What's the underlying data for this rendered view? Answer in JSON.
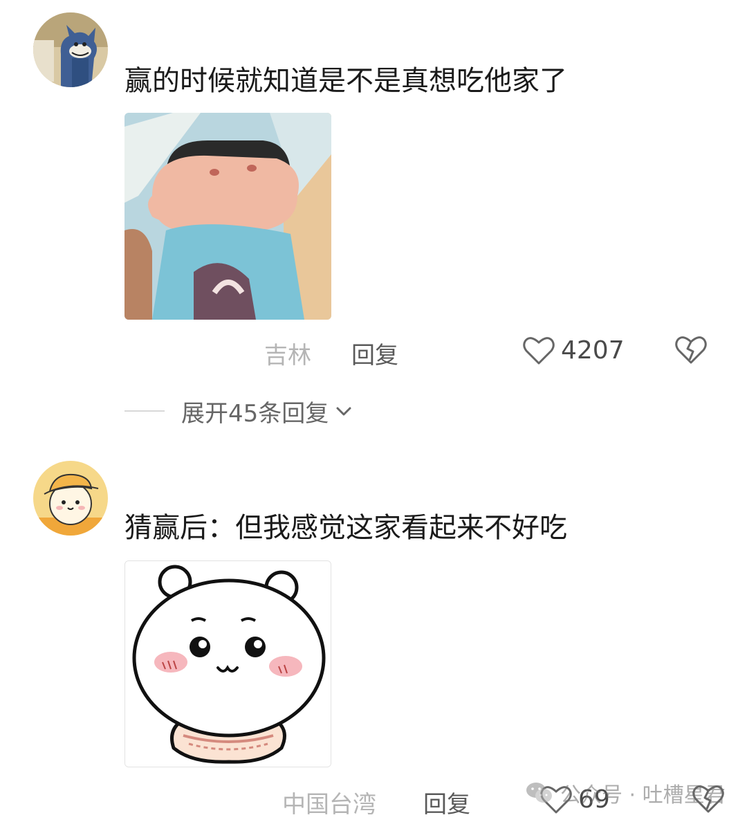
{
  "comments": [
    {
      "avatar_icon": "cartoon-cat-avatar-icon",
      "text": "赢的时候就知道是不是真想吃他家了",
      "sticker_icon": "crayon-shin-chan-sticker-icon",
      "location": "吉林",
      "reply_label": "回复",
      "like_count": "4207",
      "expand_label": "展开45条回复"
    },
    {
      "avatar_icon": "yellow-bear-avatar-icon",
      "text": "猜赢后：但我感觉这家看起来不好吃",
      "sticker_icon": "chiikawa-sticker-icon",
      "location": "中国台湾",
      "reply_label": "回复",
      "like_count": "69"
    }
  ],
  "watermark": {
    "icon": "wechat-icon",
    "text": "公众号 · 吐槽星君"
  },
  "colors": {
    "text_primary": "#1a1a1a",
    "text_secondary": "#b5b5b5",
    "reply_text": "#5a5a5a",
    "icon_stroke": "#666666"
  }
}
